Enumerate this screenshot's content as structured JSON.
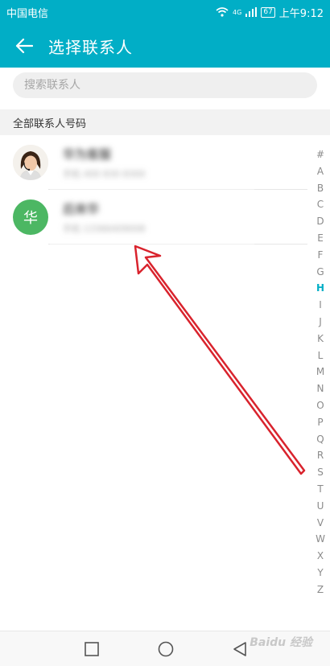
{
  "status_bar": {
    "carrier": "中国电信",
    "network": "4G",
    "battery": "67",
    "time": "上午9:12"
  },
  "header": {
    "back_icon": "arrow-left-icon",
    "title": "选择联系人"
  },
  "search": {
    "placeholder": "搜索联系人",
    "value": ""
  },
  "section": {
    "title": "全部联系人号码"
  },
  "contacts": [
    {
      "name": "华为客服",
      "phone": "手机 400 830 8300",
      "avatar_type": "photo"
    },
    {
      "name": "后来华",
      "phone": "手机 13366409008",
      "avatar_type": "letter",
      "avatar_letter": "华",
      "avatar_color": "#4cb763"
    }
  ],
  "index_letters": [
    "#",
    "A",
    "B",
    "C",
    "D",
    "E",
    "F",
    "G",
    "H",
    "I",
    "J",
    "K",
    "L",
    "M",
    "N",
    "O",
    "P",
    "Q",
    "R",
    "S",
    "T",
    "U",
    "V",
    "W",
    "X",
    "Y",
    "Z"
  ],
  "index_active": "H",
  "colors": {
    "accent": "#01aec6",
    "annotation": "#d9232d"
  },
  "nav_bar": {
    "recent_icon": "square-icon",
    "home_icon": "circle-icon",
    "back_icon": "triangle-back-icon"
  },
  "watermark": "Baidu 经验"
}
